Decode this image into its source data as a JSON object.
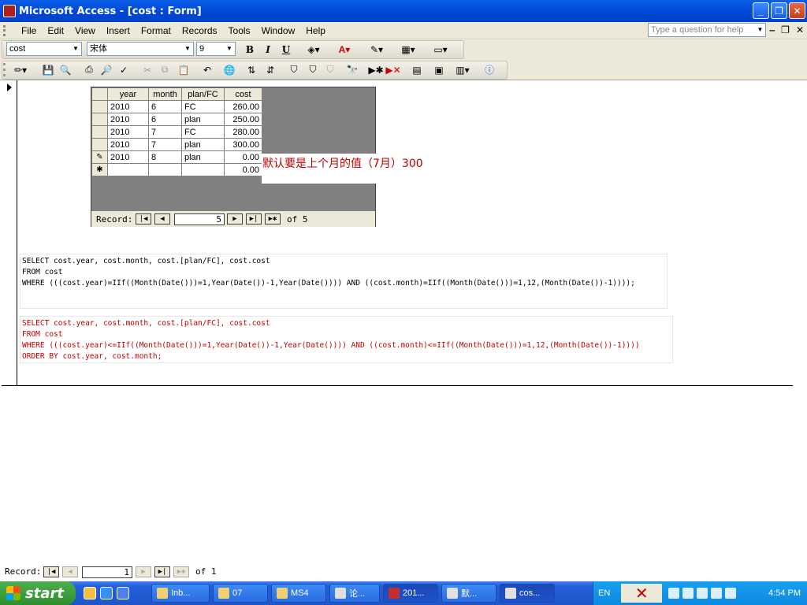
{
  "window": {
    "title": "Microsoft Access - [cost : Form]"
  },
  "menu": [
    "File",
    "Edit",
    "View",
    "Insert",
    "Format",
    "Records",
    "Tools",
    "Window",
    "Help"
  ],
  "help_placeholder": "Type a question for help",
  "formatting": {
    "object": "cost",
    "font": "宋体",
    "size": "9",
    "bold": "B",
    "italic": "I",
    "underline": "U"
  },
  "subform": {
    "columns": [
      "year",
      "month",
      "plan/FC",
      "cost"
    ],
    "rows": [
      {
        "sel": "",
        "year": "2010",
        "month": "6",
        "plan": "FC",
        "cost": "260.00"
      },
      {
        "sel": "",
        "year": "2010",
        "month": "6",
        "plan": "plan",
        "cost": "250.00"
      },
      {
        "sel": "",
        "year": "2010",
        "month": "7",
        "plan": "FC",
        "cost": "280.00"
      },
      {
        "sel": "",
        "year": "2010",
        "month": "7",
        "plan": "plan",
        "cost": "300.00"
      },
      {
        "sel": "✎",
        "year": "2010",
        "month": "8",
        "plan": "plan",
        "cost": "0.00"
      },
      {
        "sel": "✱",
        "year": "",
        "month": "",
        "plan": "",
        "cost": "0.00"
      }
    ],
    "nav": {
      "label": "Record:",
      "current": "5",
      "of": "of 5"
    }
  },
  "annotation": "默认要是上个月的值（7月）300",
  "sql1": "SELECT cost.year, cost.month, cost.[plan/FC], cost.cost\nFROM cost\nWHERE (((cost.year)=IIf((Month(Date()))=1,Year(Date())-1,Year(Date()))) AND ((cost.month)=IIf((Month(Date()))=1,12,(Month(Date())-1))));",
  "sql2": "SELECT cost.year, cost.month, cost.[plan/FC], cost.cost\nFROM cost\nWHERE (((cost.year)<=IIf((Month(Date()))=1,Year(Date())-1,Year(Date()))) AND ((cost.month)<=IIf((Month(Date()))=1,12,(Month(Date())-1))))\nORDER BY cost.year, cost.month;",
  "main_nav": {
    "label": "Record:",
    "current": "1",
    "of": "of 1"
  },
  "taskbar": {
    "start": "start",
    "tasks": [
      "Inb...",
      "07",
      "MS4",
      "论...",
      "201...",
      "默...",
      "cos..."
    ],
    "lang": "EN",
    "clock": "4:54 PM"
  }
}
